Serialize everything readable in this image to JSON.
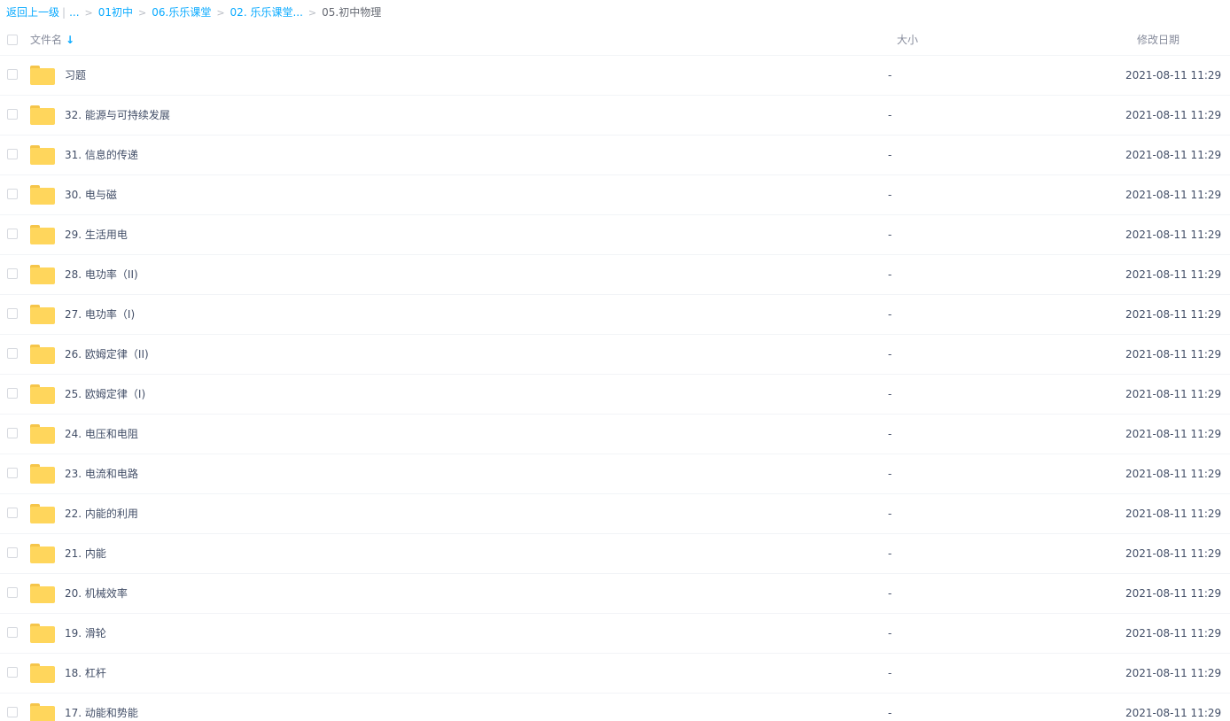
{
  "breadcrumb": {
    "back": "返回上一级",
    "separator": "|",
    "ellipsis": "...",
    "arrow": ">",
    "crumbs": [
      "01初中",
      "06.乐乐课堂",
      "02. 乐乐课堂..."
    ],
    "current": "05.初中物理"
  },
  "header": {
    "name": "文件名",
    "sort_icon": "arrow-down-icon",
    "sort_glyph": "↓",
    "size": "大小",
    "modified": "修改日期"
  },
  "colors": {
    "accent": "#09aaff",
    "folder": "#ffd65c"
  },
  "rows": [
    {
      "name": "习题",
      "size": "-",
      "date": "2021-08-11 11:29"
    },
    {
      "name": "32. 能源与可持续发展",
      "size": "-",
      "date": "2021-08-11 11:29"
    },
    {
      "name": "31. 信息的传递",
      "size": "-",
      "date": "2021-08-11 11:29"
    },
    {
      "name": "30. 电与磁",
      "size": "-",
      "date": "2021-08-11 11:29"
    },
    {
      "name": "29. 生活用电",
      "size": "-",
      "date": "2021-08-11 11:29"
    },
    {
      "name": "28. 电功率（II)",
      "size": "-",
      "date": "2021-08-11 11:29"
    },
    {
      "name": "27. 电功率（I)",
      "size": "-",
      "date": "2021-08-11 11:29"
    },
    {
      "name": "26. 欧姆定律（II)",
      "size": "-",
      "date": "2021-08-11 11:29"
    },
    {
      "name": "25. 欧姆定律（I)",
      "size": "-",
      "date": "2021-08-11 11:29"
    },
    {
      "name": "24. 电压和电阻",
      "size": "-",
      "date": "2021-08-11 11:29"
    },
    {
      "name": "23. 电流和电路",
      "size": "-",
      "date": "2021-08-11 11:29"
    },
    {
      "name": "22. 内能的利用",
      "size": "-",
      "date": "2021-08-11 11:29"
    },
    {
      "name": "21. 内能",
      "size": "-",
      "date": "2021-08-11 11:29"
    },
    {
      "name": "20. 机械效率",
      "size": "-",
      "date": "2021-08-11 11:29"
    },
    {
      "name": "19. 滑轮",
      "size": "-",
      "date": "2021-08-11 11:29"
    },
    {
      "name": "18. 杠杆",
      "size": "-",
      "date": "2021-08-11 11:29"
    },
    {
      "name": "17. 动能和势能",
      "size": "-",
      "date": "2021-08-11 11:29"
    }
  ]
}
